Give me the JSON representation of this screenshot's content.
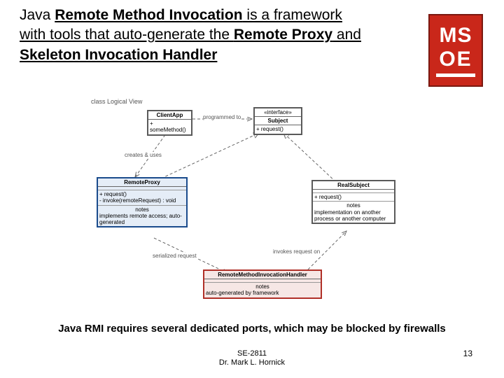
{
  "heading": {
    "p1a": "Java ",
    "p1b": "Remote Method Invocation",
    "p1c": " is a framework with tools that auto-generate the ",
    "p2a": "Remote Proxy",
    "p2b": " and ",
    "p2c": "Skeleton Invocation Handler"
  },
  "logo": {
    "line1": "MS",
    "line2": "OE"
  },
  "diagram": {
    "title": "class Logical View",
    "client": {
      "title": "ClientApp",
      "method": "+ someMethod()"
    },
    "subject": {
      "stereo": "«interface»",
      "title": "Subject",
      "method": "+ request()"
    },
    "proxy": {
      "title": "RemoteProxy",
      "m1": "+ request()",
      "m2": "- invoke(remoteRequest) : void",
      "noteTitle": "notes",
      "noteBody": "implements remote access; auto-generated"
    },
    "real": {
      "title": "RealSubject",
      "m1": "+ request()",
      "noteTitle": "notes",
      "noteBody": "implementation on another process or another computer"
    },
    "handler": {
      "title": "RemoteMethodInvocationHandler",
      "noteTitle": "notes",
      "noteBody": "auto-generated by framework"
    },
    "labels": {
      "programmedTo": "programmed to",
      "createsUses": "creates & uses",
      "serialized": "serialized request",
      "invokes": "invokes request on"
    }
  },
  "caption": "Java RMI requires several dedicated ports, which may be blocked by firewalls",
  "footer": {
    "course": "SE-2811",
    "author": "Dr. Mark L. Hornick"
  },
  "page": "13"
}
